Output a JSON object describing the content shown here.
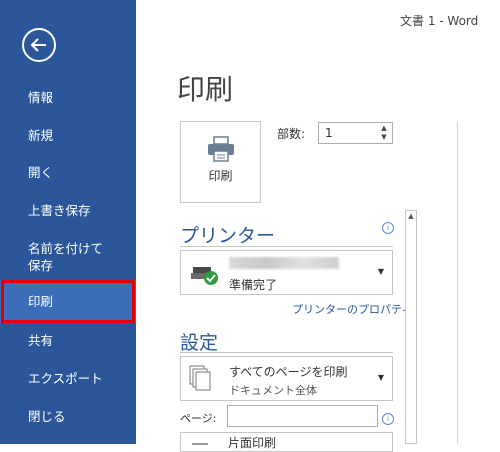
{
  "window": {
    "title": "文書 1 - Word"
  },
  "sidebar": {
    "items": [
      {
        "label": "情報"
      },
      {
        "label": "新規"
      },
      {
        "label": "開く"
      },
      {
        "label": "上書き保存"
      },
      {
        "label": "名前を付けて\n保存"
      },
      {
        "label": "印刷",
        "selected": true
      },
      {
        "label": "共有"
      },
      {
        "label": "エクスポート"
      },
      {
        "label": "閉じる"
      }
    ],
    "colors": {
      "background": "#2b579a",
      "selected": "#3c6eb8",
      "highlight": "#e00000"
    }
  },
  "main": {
    "page_title": "印刷",
    "print_button_label": "印刷",
    "copies_label": "部数:",
    "copies_value": "1",
    "printer_section": {
      "heading": "プリンター",
      "status": "準備完了",
      "properties_link": "プリンターのプロパティ"
    },
    "settings_section": {
      "heading": "設定",
      "print_range_main": "すべてのページを印刷",
      "print_range_sub": "ドキュメント全体",
      "pages_label": "ページ:",
      "pages_value": "",
      "partial_next": "片面印刷"
    },
    "accent_color": "#2b579a"
  }
}
